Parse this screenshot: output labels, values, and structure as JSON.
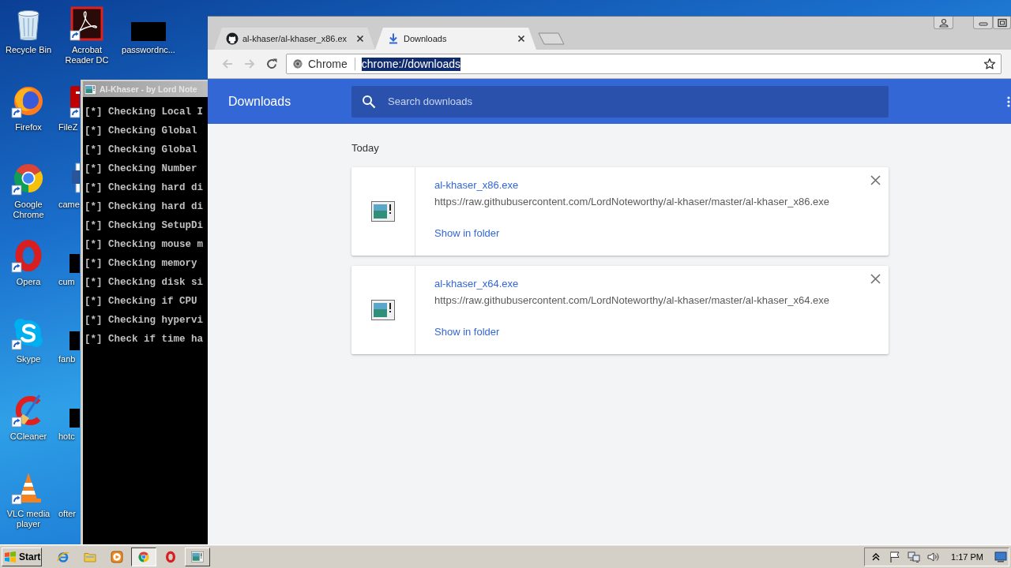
{
  "desktop": {
    "columns": [
      [
        {
          "label": "Recycle Bin",
          "kind": "recycle-bin",
          "shortcut": false,
          "covered": false
        },
        {
          "label": "Firefox",
          "kind": "firefox",
          "shortcut": true,
          "covered": false
        },
        {
          "label": "Google Chrome",
          "kind": "chrome",
          "shortcut": true,
          "covered": false
        },
        {
          "label": "Opera",
          "kind": "opera",
          "shortcut": true,
          "covered": false
        },
        {
          "label": "Skype",
          "kind": "skype",
          "shortcut": true,
          "covered": false
        },
        {
          "label": "CCleaner",
          "kind": "ccleaner",
          "shortcut": true,
          "covered": false
        },
        {
          "label": "VLC media player",
          "kind": "vlc",
          "shortcut": true,
          "covered": false
        }
      ],
      [
        {
          "label": "Acrobat Reader DC",
          "kind": "acrobat",
          "shortcut": true,
          "covered": false
        },
        {
          "label": "FileZ",
          "kind": "filezilla",
          "shortcut": true,
          "covered": true
        },
        {
          "label": "came",
          "kind": "document",
          "shortcut": false,
          "covered": true
        },
        {
          "label": "cum",
          "kind": "redacted",
          "shortcut": false,
          "covered": true
        },
        {
          "label": "fanb",
          "kind": "redacted",
          "shortcut": false,
          "covered": true
        },
        {
          "label": "hotc",
          "kind": "redacted",
          "shortcut": false,
          "covered": true
        },
        {
          "label": "ofter",
          "shortcut": false,
          "covered": true
        }
      ],
      [
        {
          "label": "passwordnc...",
          "kind": "redacted",
          "shortcut": false,
          "covered": false
        }
      ]
    ]
  },
  "console": {
    "title": "Al-Khaser - by Lord Note",
    "lines": [
      "[*] Checking Local I",
      "[*] Checking Global",
      "[*] Checking Global",
      "[*] Checking Number",
      "[*] Checking hard di",
      "[*] Checking hard di",
      "[*] Checking SetupDi",
      "[*] Checking mouse m",
      "[*] Checking memory",
      "[*] Checking disk si",
      "[*] Checking if CPU",
      "[*] Checking hypervi",
      "[*] Check if time ha"
    ]
  },
  "browser": {
    "tabs": [
      {
        "title": "al-khaser/al-khaser_x86.ex",
        "kind": "github",
        "selected": false
      },
      {
        "title": "Downloads",
        "kind": "download",
        "selected": true
      }
    ],
    "navigation": {
      "back": {
        "disabled": true
      },
      "forward": {
        "disabled": true
      }
    },
    "omnibox": {
      "chip": "Chrome",
      "url": "chrome://downloads",
      "highlighted": true
    },
    "page": {
      "title": "Downloads",
      "search": {
        "placeholder": "Search downloads"
      },
      "section": "Today",
      "downloads": [
        {
          "name": "al-khaser_x86.exe",
          "url": "https://raw.githubusercontent.com/LordNoteworthy/al-khaser/master/al-khaser_x86.exe",
          "action": "Show in folder"
        },
        {
          "name": "al-khaser_x64.exe",
          "url": "https://raw.githubusercontent.com/LordNoteworthy/al-khaser/master/al-khaser_x64.exe",
          "action": "Show in folder"
        }
      ]
    }
  },
  "taskbar": {
    "start": "Start",
    "items": [
      {
        "kind": "ie",
        "running": false,
        "selected": false
      },
      {
        "kind": "explorer",
        "running": false,
        "selected": false
      },
      {
        "kind": "media-player",
        "running": false,
        "selected": false
      },
      {
        "kind": "chrome",
        "running": true,
        "selected": true
      },
      {
        "kind": "opera",
        "running": false,
        "selected": false
      },
      {
        "kind": "console",
        "running": true,
        "selected": false
      }
    ],
    "clock": "1:17 PM"
  }
}
